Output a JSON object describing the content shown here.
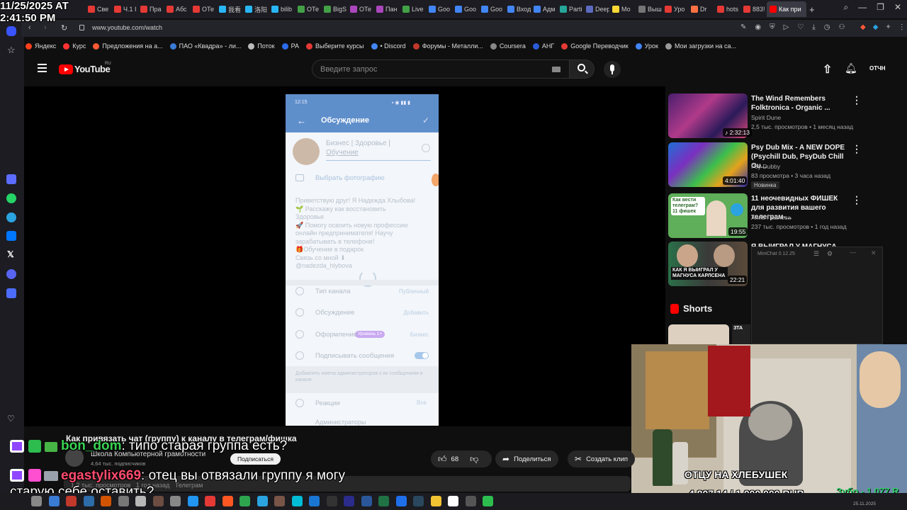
{
  "overlay": {
    "date": "11/25/2025 AT",
    "time": "2:41:50 PM"
  },
  "tabs": [
    {
      "label": "Све",
      "color": "#e53935"
    },
    {
      "label": "Ч.1 I",
      "color": "#e53935"
    },
    {
      "label": "Пра",
      "color": "#e53935"
    },
    {
      "label": "Абс",
      "color": "#e53935"
    },
    {
      "label": "ОТе",
      "color": "#e53935"
    },
    {
      "label": "我看",
      "color": "#29b6f6"
    },
    {
      "label": "洛阳",
      "color": "#29b6f6"
    },
    {
      "label": "bilib",
      "color": "#29b6f6"
    },
    {
      "label": "ОТе",
      "color": "#43a047"
    },
    {
      "label": "BigS",
      "color": "#43a047"
    },
    {
      "label": "ОТе",
      "color": "#ab47bc"
    },
    {
      "label": "Пан",
      "color": "#ab47bc"
    },
    {
      "label": "Live",
      "color": "#43a047"
    },
    {
      "label": "Goo",
      "color": "#4285f4"
    },
    {
      "label": "Goo",
      "color": "#4285f4"
    },
    {
      "label": "Goo",
      "color": "#4285f4"
    },
    {
      "label": "Вход",
      "color": "#4285f4"
    },
    {
      "label": "Адм",
      "color": "#4285f4"
    },
    {
      "label": "Parti",
      "color": "#26a69a"
    },
    {
      "label": "Deep",
      "color": "#5c6bc0"
    },
    {
      "label": "Мо",
      "color": "#fdd835"
    },
    {
      "label": "Выш",
      "color": "#757575"
    },
    {
      "label": "Уро",
      "color": "#e53935"
    },
    {
      "label": "Dr",
      "color": "#ff7043"
    },
    {
      "label": "hots",
      "color": "#e53935"
    },
    {
      "label": "883!",
      "color": "#e53935"
    },
    {
      "label": "Как при",
      "color": "#ff0000",
      "active": true
    }
  ],
  "address": {
    "url": "www.youtube.com/watch"
  },
  "bookmarks": [
    "Яндекс",
    "Курс",
    "Предложения на а...",
    "ПАО «Квадра» - ли...",
    "Поток",
    "РА",
    "Выберите курсы",
    "• Discord",
    "Форумы - Металли...",
    "Coursera",
    "АНГ",
    "Google Переводчик",
    "Урок",
    "Мои загрузки на са..."
  ],
  "youtube": {
    "logo": "YouTube",
    "region": "RU",
    "search_placeholder": "Введите запрос",
    "avatar": "ОТЧН"
  },
  "phone": {
    "status_time": "12:15",
    "title": "Обсуждение",
    "channel_name": "Бизнес | Здоровье |",
    "channel_sub": "Обучение",
    "choose_photo": "Выбрать фотографию",
    "description": [
      "Приветствую друг! Я Надежда Хлыбова!",
      "🌱 Расскажу как восстановить",
      "Здоровье",
      "🚀 Помогу освоить новую профессию",
      "онлайн предпринимателя! Научу",
      "зарабатывать в телефоне!",
      "🎁Обучение в подарок",
      "Связь со мной ⬇",
      "@nadezda_hlybova"
    ],
    "rows": [
      {
        "label": "Тип канала",
        "value": "Публичный"
      },
      {
        "label": "Обсуждение",
        "value": "Добавить"
      },
      {
        "label": "Оформление",
        "value": "Бизнес"
      },
      {
        "label": "Подписывать сообщения",
        "value": ""
      }
    ],
    "badge": "Уровень 1+",
    "hint": "Добавлять имена администраторов к их сообщениям в канале.",
    "reactions": {
      "label": "Реакции",
      "value": "Все"
    },
    "admins": "Администраторы"
  },
  "video": {
    "title": "Как привязать чат (группу) к каналу в телеграм/фишка",
    "channel": "Школа Компьютерной грамотности",
    "subscribers": "4,64 тыс. подписчиков",
    "subscribe": "Подписаться",
    "views": "1,3 тыс. просмотров",
    "age": "1 год назад",
    "tag": "Телеграм",
    "likes": "68",
    "share": "Поделиться",
    "clip": "Создать клип"
  },
  "recommendations": [
    {
      "title": "The Wind Remembers Folktronica - Organic ...",
      "channel": "Spirit Dune",
      "meta": "2,5 тыс. просмотров • 1 месяц назад",
      "duration": "2:32:13",
      "badge": ""
    },
    {
      "title": "Psy Dub Mix - A NEW DOPE (Psychill Dub, PsyDub Chill Ou...",
      "channel": "Psy Dubby",
      "meta": "83 просмотра • 3 часа назад",
      "duration": "4:01:40",
      "badge": "Новинка"
    },
    {
      "title": "11 неочевидных ФИШЕК для развития вашего телеграм-...",
      "channel": "Анна Павлова",
      "meta": "237 тыс. просмотров • 1 год назад",
      "duration": "19:55",
      "badge": "",
      "thumb_text": "Как вести телеграм? 11 фишек"
    },
    {
      "title": "Я ВЫИГРАЛ У МАГНУСА...",
      "channel": "",
      "meta": "",
      "duration": "22:21",
      "badge": "",
      "thumb_text": "КАК Я ВЫИГРАЛ У МАГНУСА КАРЛСЕНА"
    }
  ],
  "shorts": {
    "label": "Shorts",
    "thumb_text": "ЗТА"
  },
  "minichat": {
    "title": "MiniChat 0.12.25"
  },
  "chat": [
    {
      "user": "bon_dom",
      "message": ": типо старая группа есть?",
      "color": "#3ad353"
    },
    {
      "user": "egastylix669",
      "message": ": отец вы отвязали группу я могу",
      "message2": "старую себе оставить?",
      "color": "#ff4b6e"
    }
  ],
  "stream": {
    "caption": "ОТЦУ НА ХЛЕБУШЕК",
    "goal": "4 807.14 / 1 000 000 RUB",
    "ticker": "Зубр - 1 077 R"
  },
  "taskbar": {
    "date": "25.11.2025"
  }
}
